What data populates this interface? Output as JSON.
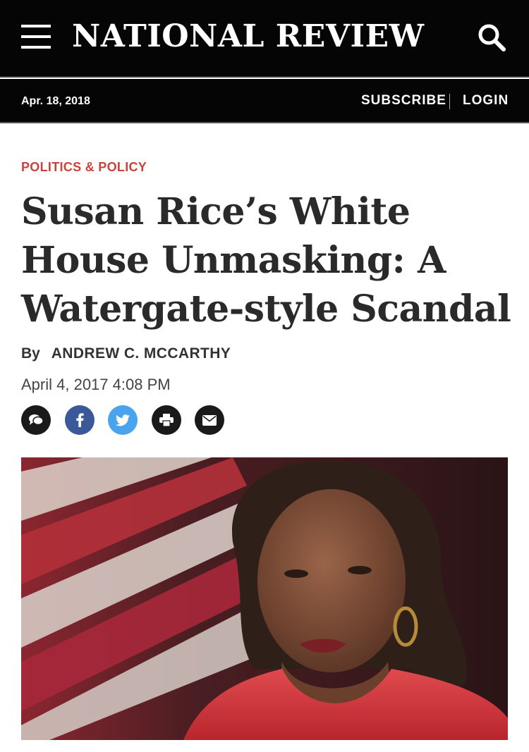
{
  "header": {
    "site_name": "NATIONAL REVIEW",
    "date": "Apr. 18, 2018",
    "subscribe_label": "SUBSCRIBE",
    "login_label": "LOGIN"
  },
  "article": {
    "category": "POLITICS & POLICY",
    "headline": "Susan Rice’s White House Unmasking: A Watergate-style Scandal",
    "byline_prefix": "By",
    "author": "ANDREW C. MCCARTHY",
    "timestamp": "April 4, 2017 4:08 PM"
  },
  "share": {
    "buttons": [
      {
        "icon": "comment-icon",
        "color": "#1a1a1a"
      },
      {
        "icon": "facebook-icon",
        "color": "#3b5998"
      },
      {
        "icon": "twitter-icon",
        "color": "#4aa3ed"
      },
      {
        "icon": "print-icon",
        "color": "#1a1a1a"
      },
      {
        "icon": "email-icon",
        "color": "#1a1a1a"
      }
    ]
  },
  "colors": {
    "header_bg": "#050505",
    "category": "#c9443b",
    "headline": "#2a2a2a"
  }
}
